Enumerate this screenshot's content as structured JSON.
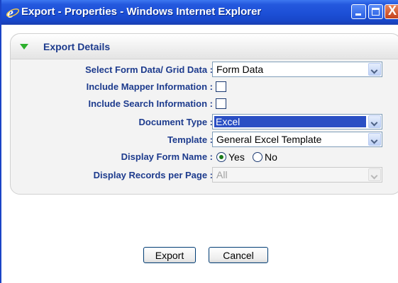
{
  "window": {
    "title": "Export - Properties - Windows Internet Explorer",
    "close_glyph": "X"
  },
  "panel": {
    "title": "Export Details"
  },
  "form": {
    "select_data": {
      "label": "Select Form Data/ Grid Data :",
      "value": "Form Data"
    },
    "include_mapper": {
      "label": "Include Mapper Information :",
      "checked": false
    },
    "include_search": {
      "label": "Include Search Information :",
      "checked": false
    },
    "document_type": {
      "label": "Document Type :",
      "value": "Excel"
    },
    "template": {
      "label": "Template :",
      "value": "General Excel Template"
    },
    "display_form_name": {
      "label": "Display Form Name :",
      "yes": "Yes",
      "no": "No",
      "selected": "Yes"
    },
    "records_per_page": {
      "label": "Display Records per Page :",
      "value": "All"
    }
  },
  "buttons": {
    "export": "Export",
    "cancel": "Cancel"
  },
  "colors": {
    "titlebar": "#2458de",
    "label_text": "#1d3b8d",
    "selection": "#2a4fc4",
    "triangle": "#2db02d"
  }
}
